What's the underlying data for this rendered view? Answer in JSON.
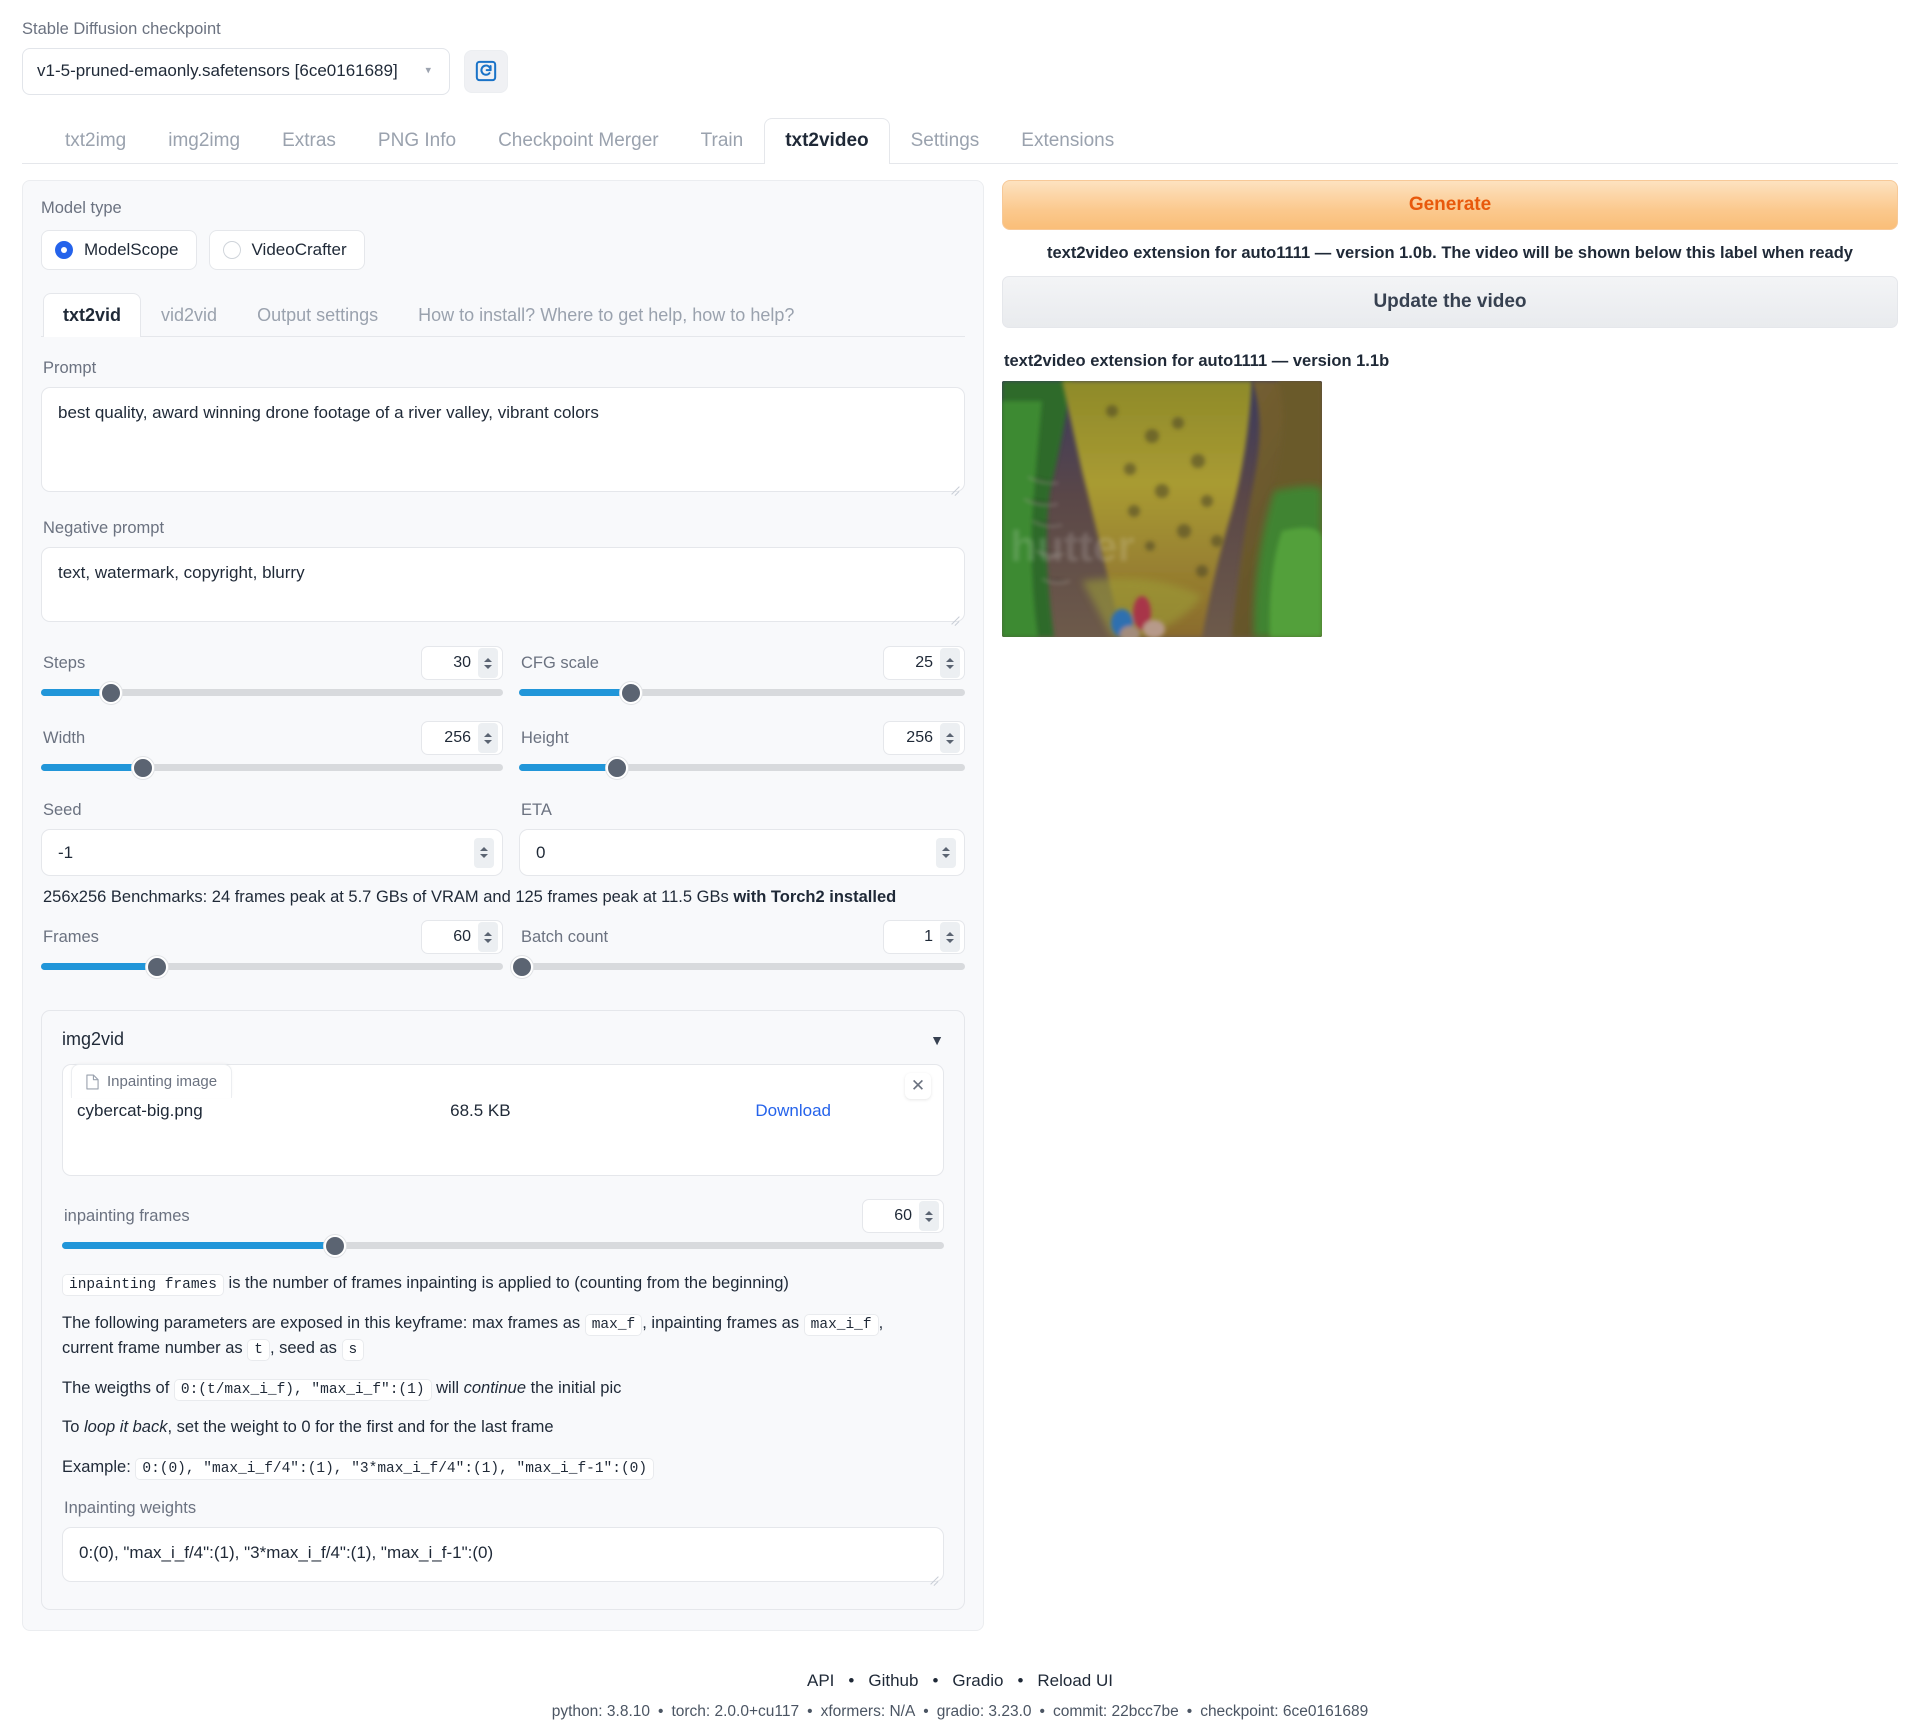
{
  "checkpoint": {
    "label": "Stable Diffusion checkpoint",
    "value": "v1-5-pruned-emaonly.safetensors [6ce0161689]",
    "refresh_icon": "refresh-icon"
  },
  "main_tabs": [
    {
      "label": "txt2img",
      "active": false
    },
    {
      "label": "img2img",
      "active": false
    },
    {
      "label": "Extras",
      "active": false
    },
    {
      "label": "PNG Info",
      "active": false
    },
    {
      "label": "Checkpoint Merger",
      "active": false
    },
    {
      "label": "Train",
      "active": false
    },
    {
      "label": "txt2video",
      "active": true
    },
    {
      "label": "Settings",
      "active": false
    },
    {
      "label": "Extensions",
      "active": false
    }
  ],
  "model_type": {
    "label": "Model type",
    "options": [
      {
        "label": "ModelScope",
        "selected": true
      },
      {
        "label": "VideoCrafter",
        "selected": false
      }
    ]
  },
  "sub_tabs": [
    {
      "label": "txt2vid",
      "active": true
    },
    {
      "label": "vid2vid",
      "active": false
    },
    {
      "label": "Output settings",
      "active": false
    },
    {
      "label": "How to install? Where to get help, how to help?",
      "active": false
    }
  ],
  "prompt": {
    "label": "Prompt",
    "value": "best quality, award winning drone footage of a river valley, vibrant colors",
    "placeholder": ""
  },
  "negative_prompt": {
    "label": "Negative prompt",
    "value": "text, watermark, copyright, blurry",
    "placeholder": ""
  },
  "sliders": [
    {
      "name": "Steps",
      "value": "30",
      "pct": 15.2
    },
    {
      "name": "CFG scale",
      "value": "25",
      "pct": 25.0
    },
    {
      "name": "Width",
      "value": "256",
      "pct": 22.0
    },
    {
      "name": "Height",
      "value": "256",
      "pct": 22.0
    },
    {
      "name": "Frames",
      "value": "60",
      "pct": 25.0
    },
    {
      "name": "Batch count",
      "value": "1",
      "pct": 0.0
    }
  ],
  "seed": {
    "label": "Seed",
    "value": "-1"
  },
  "eta": {
    "label": "ETA",
    "value": "0"
  },
  "benchmarks": {
    "text": "256x256 Benchmarks: 24 frames peak at 5.7 GBs of VRAM and 125 frames peak at 11.5 GBs ",
    "bold": "with Torch2 installed"
  },
  "img2vid": {
    "title": "img2vid",
    "chevron": "chevron-down-icon",
    "file_tab_label": "Inpainting image",
    "file_tab_icon": "document-icon",
    "file_name": "cybercat-big.png",
    "file_size": "68.5 KB",
    "download_label": "Download",
    "close_icon": "close-icon",
    "inpaint_frames": {
      "label": "inpainting frames",
      "value": "60",
      "pct": 31.0
    },
    "docs": {
      "line1_code": "inpainting frames",
      "line1_text": " is the number of frames inpainting is applied to (counting from the beginning)",
      "line2_a": "The following parameters are exposed in this keyframe: max frames as ",
      "line2_code1": "max_f",
      "line2_b": ", inpainting frames as ",
      "line2_code2": "max_i_f",
      "line2_c": ",",
      "line3_a": "current frame number as ",
      "line3_code1": "t",
      "line3_b": ", seed as ",
      "line3_code2": "s",
      "line4_a": "The weigths of ",
      "line4_code": "0:(t/max_i_f), \"max_i_f\":(1)",
      "line4_b": " will ",
      "line4_em": "continue",
      "line4_c": " the initial pic",
      "line5_a": "To ",
      "line5_em": "loop it back",
      "line5_b": ", set the weight to 0 for the first and for the last frame",
      "line6_a": "Example: ",
      "line6_code": "0:(0), \"max_i_f/4\":(1), \"3*max_i_f/4\":(1), \"max_i_f-1\":(0)"
    },
    "weights": {
      "label": "Inpainting weights",
      "value": "0:(0), \"max_i_f/4\":(1), \"3*max_i_f/4\":(1), \"max_i_f-1\":(0)"
    }
  },
  "right": {
    "generate_label": "Generate",
    "generate_note": "text2video extension for auto1111 — version 1.0b. The video will be shown below this label when ready",
    "update_label": "Update the video",
    "video_label": "text2video extension for auto1111 — version 1.1b",
    "video_alt": "aerial-drone-river-valley-frame"
  },
  "footer": {
    "links": [
      "API",
      "Github",
      "Gradio",
      "Reload UI"
    ],
    "versions": [
      "python: 3.8.10",
      "torch: 2.0.0+cu117",
      "xformers: N/A",
      "gradio: 3.23.0",
      "commit: 22bcc7be",
      "checkpoint: 6ce0161689"
    ]
  },
  "colors": {
    "accent_blue": "#2196d9",
    "radio_blue": "#2563eb",
    "generate_orange": "#e8590c",
    "link_blue": "#2563eb"
  }
}
